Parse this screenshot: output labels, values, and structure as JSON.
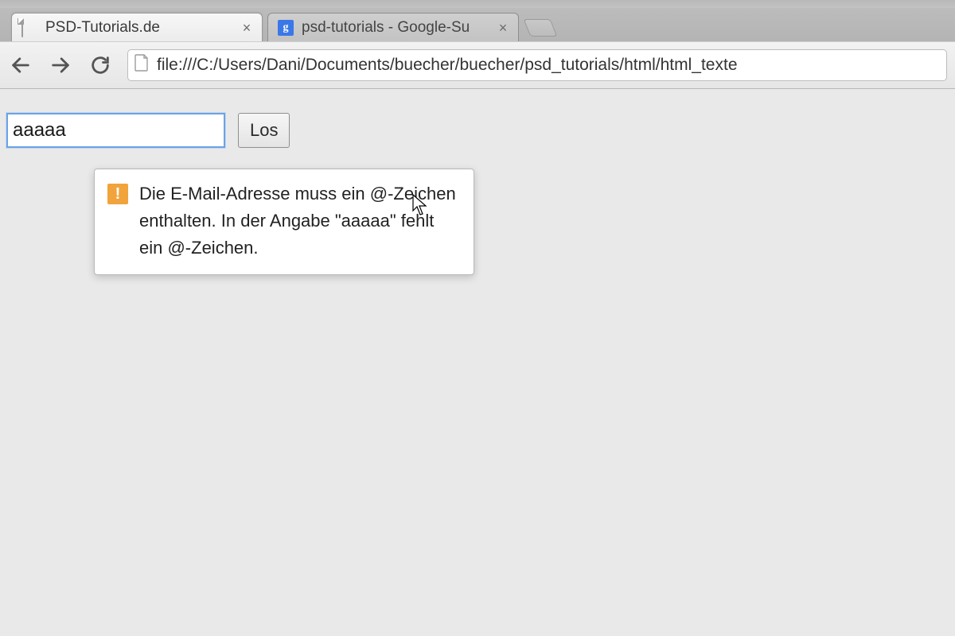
{
  "tabs": [
    {
      "title": "PSD-Tutorials.de",
      "favicon": "file-icon",
      "active": true
    },
    {
      "title": "psd-tutorials - Google-Su",
      "favicon": "google-icon",
      "active": false
    }
  ],
  "omnibox": {
    "url": "file:///C:/Users/Dani/Documents/buecher/buecher/psd_tutorials/html/html_texte"
  },
  "form": {
    "input_value": "aaaaa",
    "submit_label": "Los"
  },
  "validation_tooltip": {
    "message": "Die E-Mail-Adresse muss ein @-Zeichen enthalten. In der Angabe \"aaaaa\" fehlt ein @-Zeichen."
  }
}
